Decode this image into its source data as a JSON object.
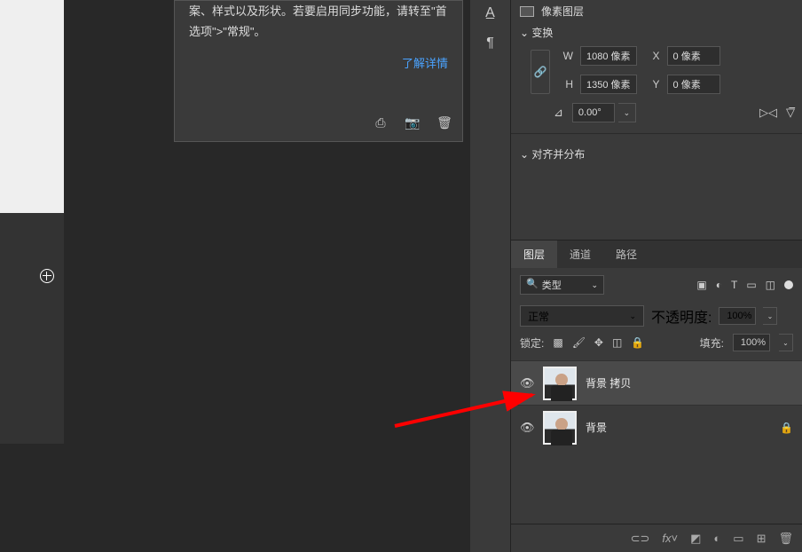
{
  "tooltip": {
    "text": "案、样式以及形状。若要启用同步功能，请转至\"首选项\">\"常规\"。",
    "link": "了解详情"
  },
  "properties": {
    "pixel_layer_label": "像素图层",
    "transform_header": "变换",
    "w_label": "W",
    "w_value": "1080 像素",
    "h_label": "H",
    "h_value": "1350 像素",
    "x_label": "X",
    "x_value": "0 像素",
    "y_label": "Y",
    "y_value": "0 像素",
    "angle_value": "0.00°",
    "align_header": "对齐并分布"
  },
  "layers_panel": {
    "tabs": {
      "layers": "图层",
      "channels": "通道",
      "paths": "路径"
    },
    "filter_label": "类型",
    "blend_mode": "正常",
    "opacity_label": "不透明度:",
    "opacity_value": "100%",
    "lock_label": "锁定:",
    "fill_label": "填充:",
    "fill_value": "100%",
    "layers": [
      {
        "name": "背景 拷贝",
        "selected": true,
        "locked": false
      },
      {
        "name": "背景",
        "selected": false,
        "locked": true
      }
    ]
  }
}
